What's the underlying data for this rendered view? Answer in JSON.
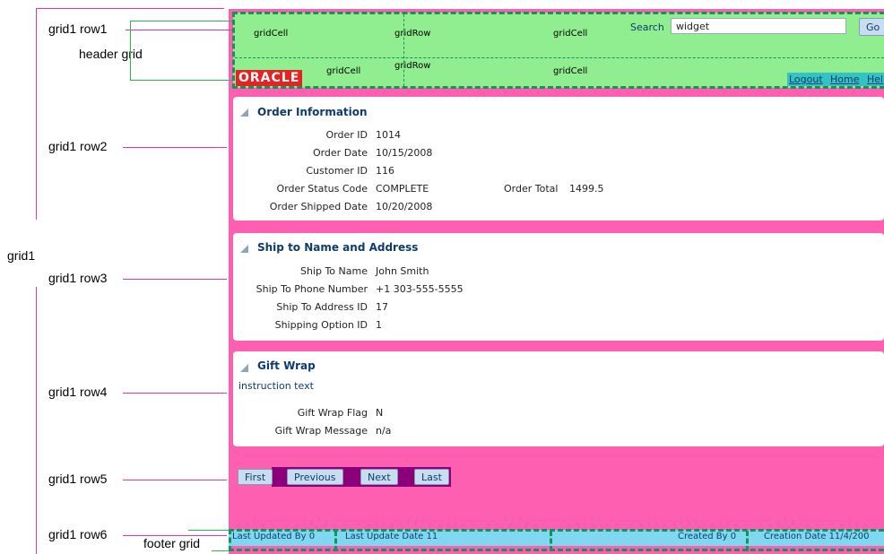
{
  "annotations": {
    "grid1_row1": "grid1 row1",
    "header_grid": "header grid",
    "grid1_row2": "grid1 row2",
    "grid1": "grid1",
    "grid1_row3": "grid1 row3",
    "grid1_row4": "grid1 row4",
    "grid1_row5": "grid1 row5",
    "grid1_row6": "grid1 row6",
    "footer_grid": "footer grid"
  },
  "header": {
    "cells_top": [
      "gridCell",
      "gridRow",
      "gridCell"
    ],
    "cells_bottom": [
      "gridCell",
      "gridRow",
      "gridCell"
    ],
    "search_label": "Search",
    "search_value": "widget",
    "go_label": "Go",
    "logo_text": "ORACLE",
    "links": [
      "Logout",
      "Home",
      "Hel"
    ]
  },
  "order_info": {
    "title": "Order Information",
    "fields": [
      {
        "label": "Order ID",
        "value": "1014"
      },
      {
        "label": "Order Date",
        "value": "10/15/2008"
      },
      {
        "label": "Customer ID",
        "value": "116"
      },
      {
        "label": "Order Status Code",
        "value": "COMPLETE"
      },
      {
        "label": "Order Shipped Date",
        "value": "10/20/2008"
      }
    ],
    "total_label": "Order Total",
    "total_value": "1499.5"
  },
  "ship_to": {
    "title": "Ship to Name and Address",
    "fields": [
      {
        "label": "Ship To Name",
        "value": "John Smith"
      },
      {
        "label": "Ship To Phone Number",
        "value": "+1 303-555-5555"
      },
      {
        "label": "Ship To Address ID",
        "value": "17"
      },
      {
        "label": "Shipping Option ID",
        "value": "1"
      }
    ]
  },
  "gift_wrap": {
    "title": "Gift Wrap",
    "instruction": "instruction text",
    "fields": [
      {
        "label": "Gift Wrap Flag",
        "value": "N"
      },
      {
        "label": "Gift Wrap Message",
        "value": "n/a"
      }
    ]
  },
  "nav_buttons": [
    "First",
    "Previous",
    "Next",
    "Last"
  ],
  "footer": {
    "last_updated_by": "Last Updated By  0",
    "last_update_date": "Last Update Date  11",
    "created_by": "Created By  0",
    "creation_date": "Creation Date  11/4/200"
  },
  "colors": {
    "page_background": "#ff5fb0",
    "header_green": "#90ee90",
    "footer_cyan": "#7fd8f0",
    "annotation_line_pink": "#e8359c",
    "grid_dash_green": "#12945f"
  }
}
